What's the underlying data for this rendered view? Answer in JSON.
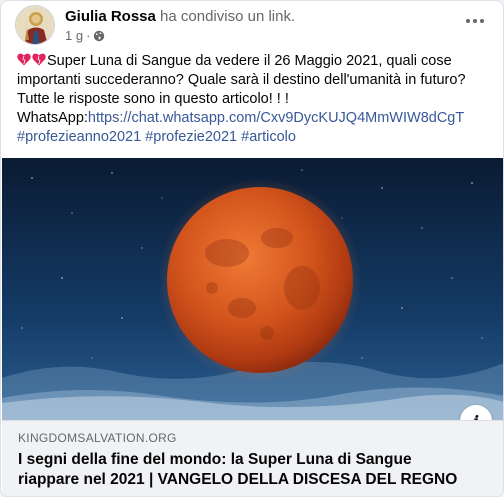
{
  "post": {
    "author": "Giulia Rossa",
    "action": "ha condiviso un link.",
    "time": "1 g",
    "separator": "·"
  },
  "icons": {
    "avatar": "religious-portrait-avatar",
    "privacy": "globe-icon",
    "more": "more-options-icon",
    "emoji": "heart-emoji-icon",
    "info": "info-icon"
  },
  "text": {
    "line1": "Super Luna di Sangue da vedere il 26 Maggio 2021, quali cose",
    "line2": "importanti succederanno? Quale sarà il destino dell'umanità in futuro?",
    "line3": "Tutte le risposte sono in questo articolo! ! !",
    "whatsapp_label": "WhatsApp:",
    "whatsapp_link": "https://chat.whatsapp.com/Cxv9DycKUJQ4MmWIW8dCgT",
    "hashtags": [
      "#profezieanno2021",
      "#profezie2021",
      "#articolo"
    ]
  },
  "preview": {
    "domain": "KINGDOMSALVATION.ORG",
    "title_line1": "I segni della fine del mondo: la Super Luna di Sangue",
    "title_line2": "riappare nel 2021 | VANGELO DELLA DISCESA DEL REGNO"
  },
  "colors": {
    "link": "#385898",
    "secondary_text": "#65676b",
    "heart": "#e0245e",
    "moon": "#d2541c",
    "sky": "#0f2f52"
  }
}
